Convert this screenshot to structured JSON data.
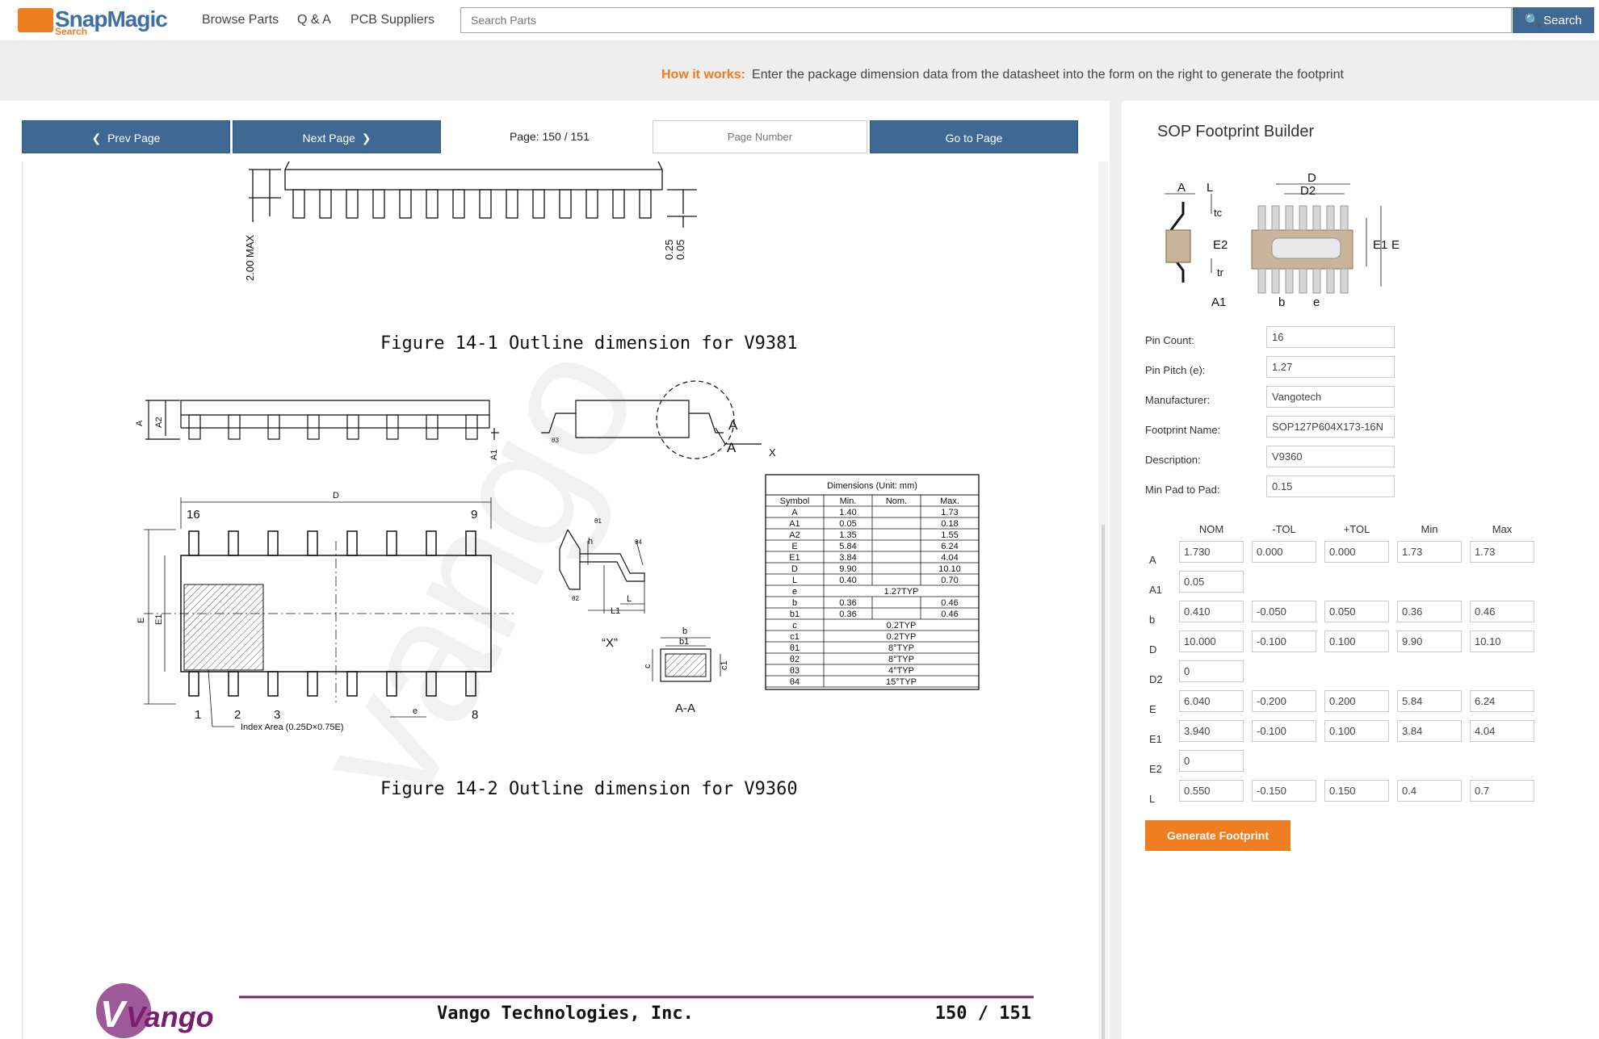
{
  "header": {
    "logo_text": "SnapMagic",
    "logo_sub": "Search",
    "nav": [
      "Browse Parts",
      "Q & A",
      "PCB Suppliers"
    ],
    "search_placeholder": "Search Parts",
    "search_button": "Search"
  },
  "how_it_works": {
    "label": "How it works:",
    "text": "Enter the package dimension data from the datasheet into the form on the right to generate the footprint"
  },
  "viewer": {
    "prev_label": "Prev Page",
    "next_label": "Next Page",
    "page_info": "Page: 150 / 151",
    "page_number_placeholder": "Page Number",
    "goto_label": "Go to Page"
  },
  "document": {
    "fig1_caption": "Figure 14-1 Outline dimension for V9381",
    "fig1_labels": {
      "max": "2.00 MAX",
      "a": "0.25",
      "b": "0.05"
    },
    "fig2_caption": "Figure 14-2 Outline dimension for V9360",
    "fig2_labels": {
      "A": "A",
      "A2": "A2",
      "A1": "A1",
      "D": "D",
      "E": "E",
      "E1": "E1",
      "pin16": "16",
      "pin9": "9",
      "pin1": "1",
      "pin2": "2",
      "pin3": "3",
      "pin8": "8",
      "e": "e",
      "index": "Index Area (0.25D×0.75E)",
      "detail_A": "A",
      "detail_X": "X",
      "view_x": "“X”",
      "section": "A-A",
      "theta1": "θ1",
      "theta2": "θ2",
      "theta3": "θ3",
      "theta4": "θ4",
      "h": "h",
      "L": "L",
      "L1": "L1",
      "b": "b",
      "b1": "b1",
      "c": "c",
      "c1": "c1"
    },
    "dim_table": {
      "title": "Dimensions (Unit: mm)",
      "headers": [
        "Symbol",
        "Min.",
        "Nom.",
        "Max."
      ],
      "rows": [
        [
          "A",
          "1.40",
          "",
          "1.73"
        ],
        [
          "A1",
          "0.05",
          "",
          "0.18"
        ],
        [
          "A2",
          "1.35",
          "",
          "1.55"
        ],
        [
          "E",
          "5.84",
          "",
          "6.24"
        ],
        [
          "E1",
          "3.84",
          "",
          "4.04"
        ],
        [
          "D",
          "9.90",
          "",
          "10.10"
        ],
        [
          "L",
          "0.40",
          "",
          "0.70"
        ],
        [
          "e",
          "1.27TYP"
        ],
        [
          "b",
          "0.36",
          "",
          "0.46"
        ],
        [
          "b1",
          "0.36",
          "",
          "0.46"
        ],
        [
          "c",
          "0.2TYP"
        ],
        [
          "c1",
          "0.2TYP"
        ],
        [
          "θ1",
          "8°TYP"
        ],
        [
          "θ2",
          "8°TYP"
        ],
        [
          "θ3",
          "4°TYP"
        ],
        [
          "θ4",
          "15°TYP"
        ]
      ]
    },
    "footer_company": "Vango Technologies, Inc.",
    "footer_page": "150  /  151",
    "footer_logo": "Vango"
  },
  "builder": {
    "title": "SOP Footprint Builder",
    "diagram_labels": {
      "A": "A",
      "L": "L",
      "tc": "tc",
      "E2": "E2",
      "tr": "tr",
      "A1": "A1",
      "D": "D",
      "D2": "D2",
      "E1": "E1",
      "E": "E",
      "b": "b",
      "e": "e"
    },
    "fields": [
      {
        "label": "Pin Count:",
        "value": "16"
      },
      {
        "label": "Pin Pitch (e):",
        "value": "1.27"
      },
      {
        "label": "Manufacturer:",
        "value": "Vangotech"
      },
      {
        "label": "Footprint Name:",
        "value": "SOP127P604X173-16N"
      },
      {
        "label": "Description:",
        "value": "V9360"
      },
      {
        "label": "Min Pad to Pad:",
        "value": "0.15"
      }
    ],
    "columns": [
      "NOM",
      "-TOL",
      "+TOL",
      "Min",
      "Max"
    ],
    "rows": [
      {
        "label": "A",
        "values": [
          "1.730",
          "0.000",
          "0.000",
          "1.73",
          "1.73"
        ]
      },
      {
        "label": "A1",
        "values": [
          "0.05"
        ]
      },
      {
        "label": "b",
        "values": [
          "0.410",
          "-0.050",
          "0.050",
          "0.36",
          "0.46"
        ]
      },
      {
        "label": "D",
        "values": [
          "10.000",
          "-0.100",
          "0.100",
          "9.90",
          "10.10"
        ]
      },
      {
        "label": "D2",
        "values": [
          "0"
        ]
      },
      {
        "label": "E",
        "values": [
          "6.040",
          "-0.200",
          "0.200",
          "5.84",
          "6.24"
        ]
      },
      {
        "label": "E1",
        "values": [
          "3.940",
          "-0.100",
          "0.100",
          "3.84",
          "4.04"
        ]
      },
      {
        "label": "E2",
        "values": [
          "0"
        ]
      },
      {
        "label": "L",
        "values": [
          "0.550",
          "-0.150",
          "0.150",
          "0.4",
          "0.7"
        ]
      }
    ],
    "generate_label": "Generate Footprint"
  },
  "colors": {
    "accent_orange": "#ef7d22",
    "brand_blue": "#3f6894",
    "vango_purple": "#7a1f6e"
  }
}
